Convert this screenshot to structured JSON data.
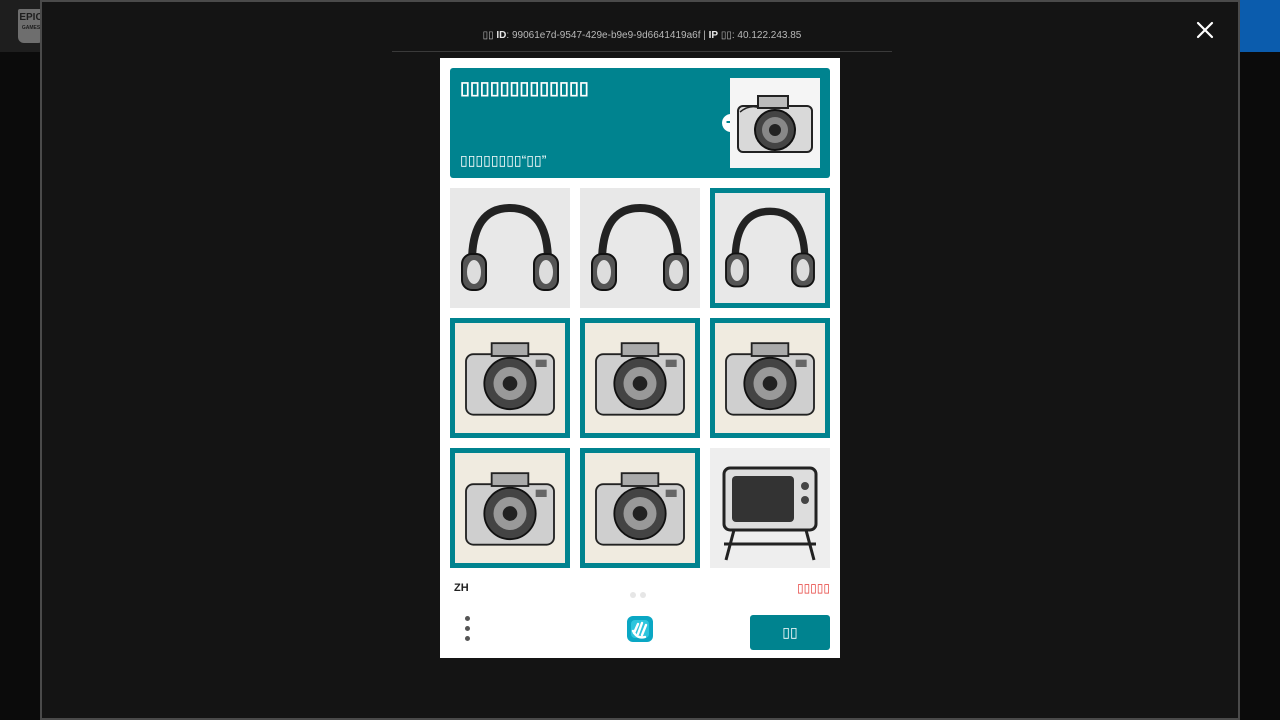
{
  "background": {
    "logo_text": "EPIC",
    "logo_sub": "GAMES"
  },
  "modal": {
    "info": {
      "id_prefix": "▯▯",
      "id_label": "ID",
      "id_value": ": 99061e7d-9547-429e-b9e9-9d6641419a6f",
      "separator": " | ",
      "ip_label": "IP",
      "ip_suffix": " ▯▯: ",
      "ip_value": "40.122.243.85"
    },
    "close_icon": "close-icon"
  },
  "captcha": {
    "prompt_title": "▯▯▯▯▯▯▯▯▯▯▯▯▯",
    "prompt_sub": "▯▯▯▯▯▯▯▯“▯▯”",
    "prompt_image": "camera-sketch",
    "tiles": [
      {
        "subject": "headphones",
        "selected": false
      },
      {
        "subject": "headphones",
        "selected": false
      },
      {
        "subject": "headphones",
        "selected": true
      },
      {
        "subject": "camera",
        "selected": true
      },
      {
        "subject": "camera",
        "selected": true
      },
      {
        "subject": "camera",
        "selected": true
      },
      {
        "subject": "camera",
        "selected": true
      },
      {
        "subject": "camera",
        "selected": true
      },
      {
        "subject": "television",
        "selected": false
      }
    ],
    "language": "ZH",
    "error_text": "▯▯▯▯▯",
    "submit_label": "▯▯",
    "colors": {
      "accent": "#00838f",
      "error": "#e53935"
    }
  }
}
